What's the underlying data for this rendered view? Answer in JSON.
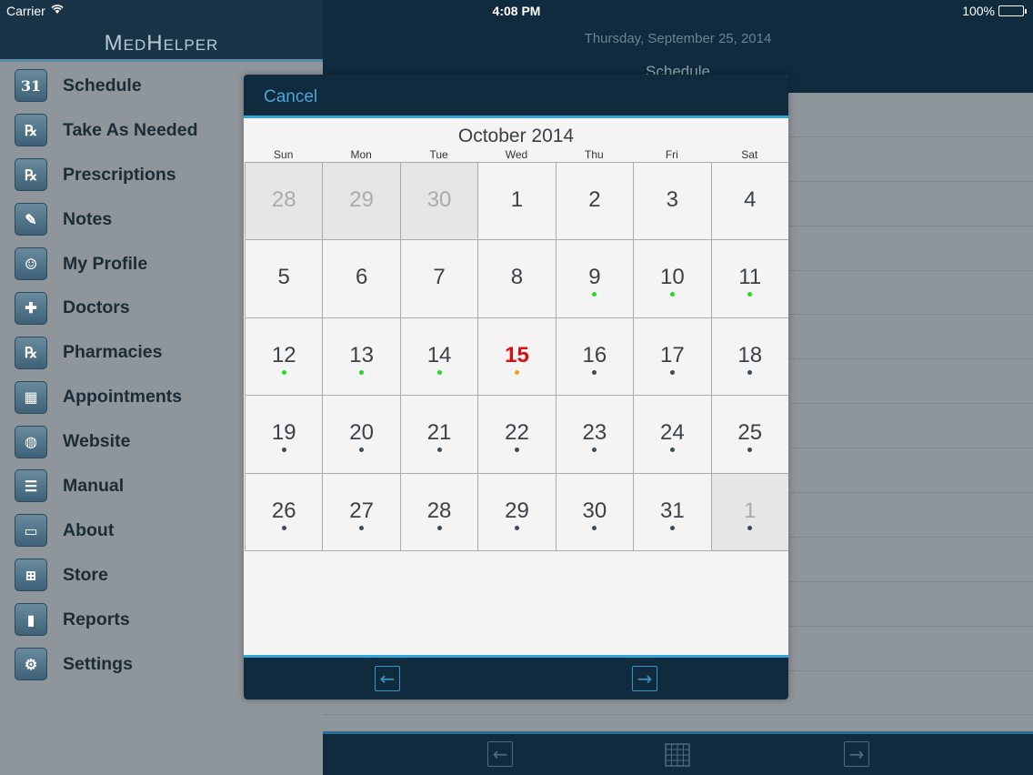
{
  "status_bar": {
    "carrier": "Carrier",
    "time": "4:08 PM",
    "battery": "100%"
  },
  "sidebar": {
    "logo": "MedHelper",
    "items": [
      {
        "label": "Schedule",
        "icon": "calendar-icon",
        "glyph": "31"
      },
      {
        "label": "Take As Needed",
        "icon": "rx-lightning-icon",
        "glyph": "℞"
      },
      {
        "label": "Prescriptions",
        "icon": "rx-icon",
        "glyph": "℞"
      },
      {
        "label": "Notes",
        "icon": "notepad-icon",
        "glyph": "✎"
      },
      {
        "label": "My Profile",
        "icon": "person-icon",
        "glyph": "☺"
      },
      {
        "label": "Doctors",
        "icon": "medical-bag-icon",
        "glyph": "✚"
      },
      {
        "label": "Pharmacies",
        "icon": "pharmacy-icon",
        "glyph": "℞"
      },
      {
        "label": "Appointments",
        "icon": "appointments-calendar-icon",
        "glyph": "▦"
      },
      {
        "label": "Website",
        "icon": "globe-icon",
        "glyph": "◍"
      },
      {
        "label": "Manual",
        "icon": "manual-book-icon",
        "glyph": "☰"
      },
      {
        "label": "About",
        "icon": "speech-bubble-icon",
        "glyph": "▭"
      },
      {
        "label": "Store",
        "icon": "cart-icon",
        "glyph": "⊞"
      },
      {
        "label": "Reports",
        "icon": "bar-chart-icon",
        "glyph": "▮"
      },
      {
        "label": "Settings",
        "icon": "gear-icon",
        "glyph": "⚙"
      }
    ]
  },
  "main": {
    "date": "Thursday, September 25, 2014",
    "title": "Schedule",
    "footer": {
      "prev_icon": "arrow-left-icon",
      "calendar_icon": "calendar-icon",
      "next_icon": "arrow-right-icon"
    }
  },
  "calendar_modal": {
    "cancel_label": "Cancel",
    "month_title": "October 2014",
    "weekdays": [
      "Sun",
      "Mon",
      "Tue",
      "Wed",
      "Thu",
      "Fri",
      "Sat"
    ],
    "colors": {
      "green": "#22dd22",
      "orange": "#f0a020",
      "dark": "#3d4a55",
      "today": "#d80f0f"
    },
    "days": [
      {
        "n": "28",
        "other": true,
        "dot": ""
      },
      {
        "n": "29",
        "other": true,
        "dot": ""
      },
      {
        "n": "30",
        "other": true,
        "dot": ""
      },
      {
        "n": "1",
        "dot": ""
      },
      {
        "n": "2",
        "dot": ""
      },
      {
        "n": "3",
        "dot": ""
      },
      {
        "n": "4",
        "dot": ""
      },
      {
        "n": "5",
        "dot": ""
      },
      {
        "n": "6",
        "dot": ""
      },
      {
        "n": "7",
        "dot": ""
      },
      {
        "n": "8",
        "dot": ""
      },
      {
        "n": "9",
        "dot": "green"
      },
      {
        "n": "10",
        "dot": "green"
      },
      {
        "n": "11",
        "dot": "green"
      },
      {
        "n": "12",
        "dot": "green"
      },
      {
        "n": "13",
        "dot": "green"
      },
      {
        "n": "14",
        "dot": "green"
      },
      {
        "n": "15",
        "dot": "orange",
        "today": true
      },
      {
        "n": "16",
        "dot": "dark"
      },
      {
        "n": "17",
        "dot": "dark"
      },
      {
        "n": "18",
        "dot": "dark"
      },
      {
        "n": "19",
        "dot": "dark"
      },
      {
        "n": "20",
        "dot": "dark"
      },
      {
        "n": "21",
        "dot": "dark"
      },
      {
        "n": "22",
        "dot": "dark"
      },
      {
        "n": "23",
        "dot": "dark"
      },
      {
        "n": "24",
        "dot": "dark"
      },
      {
        "n": "25",
        "dot": "dark"
      },
      {
        "n": "26",
        "dot": "dark"
      },
      {
        "n": "27",
        "dot": "dark"
      },
      {
        "n": "28",
        "dot": "dark"
      },
      {
        "n": "29",
        "dot": "dark"
      },
      {
        "n": "30",
        "dot": "dark"
      },
      {
        "n": "31",
        "dot": "dark"
      },
      {
        "n": "1",
        "other": true,
        "dot": "dark"
      }
    ],
    "footer": {
      "prev_icon": "arrow-left-icon",
      "next_icon": "arrow-right-icon"
    }
  }
}
